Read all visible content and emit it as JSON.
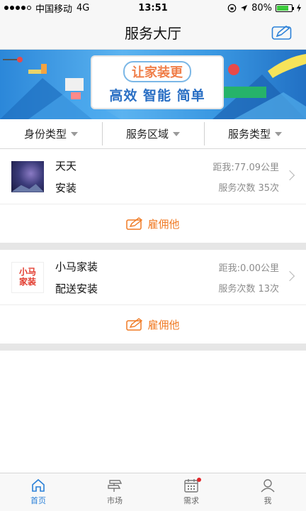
{
  "status_bar": {
    "carrier": "中国移动",
    "network": "4G",
    "time": "13:51",
    "battery": "80%",
    "battery_level": 0.8
  },
  "header": {
    "title": "服务大厅",
    "edit_icon": "edit-icon"
  },
  "banner": {
    "headline": "让家装更",
    "tagline": "高效 智能 简单"
  },
  "filters": [
    {
      "label": "身份类型"
    },
    {
      "label": "服务区域"
    },
    {
      "label": "服务类型"
    }
  ],
  "providers": [
    {
      "name": "天天",
      "service": "安装",
      "distance": "距我:77.09公里",
      "count": "服务次数 35次",
      "hire_label": "雇佣他"
    },
    {
      "name": "小马家装",
      "service": "配送安装",
      "distance": "距我:0.00公里",
      "count": "服务次数 13次",
      "hire_label": "雇佣他",
      "logo_text": "小马",
      "logo_text2": "家装"
    }
  ],
  "tabs": [
    {
      "label": "首页",
      "icon": "home-icon"
    },
    {
      "label": "市场",
      "icon": "market-icon"
    },
    {
      "label": "需求",
      "icon": "calendar-icon"
    },
    {
      "label": "我",
      "icon": "user-icon"
    }
  ],
  "colors": {
    "accent": "#2a80d8",
    "hire": "#f07a23",
    "badge": "#e2262a"
  }
}
